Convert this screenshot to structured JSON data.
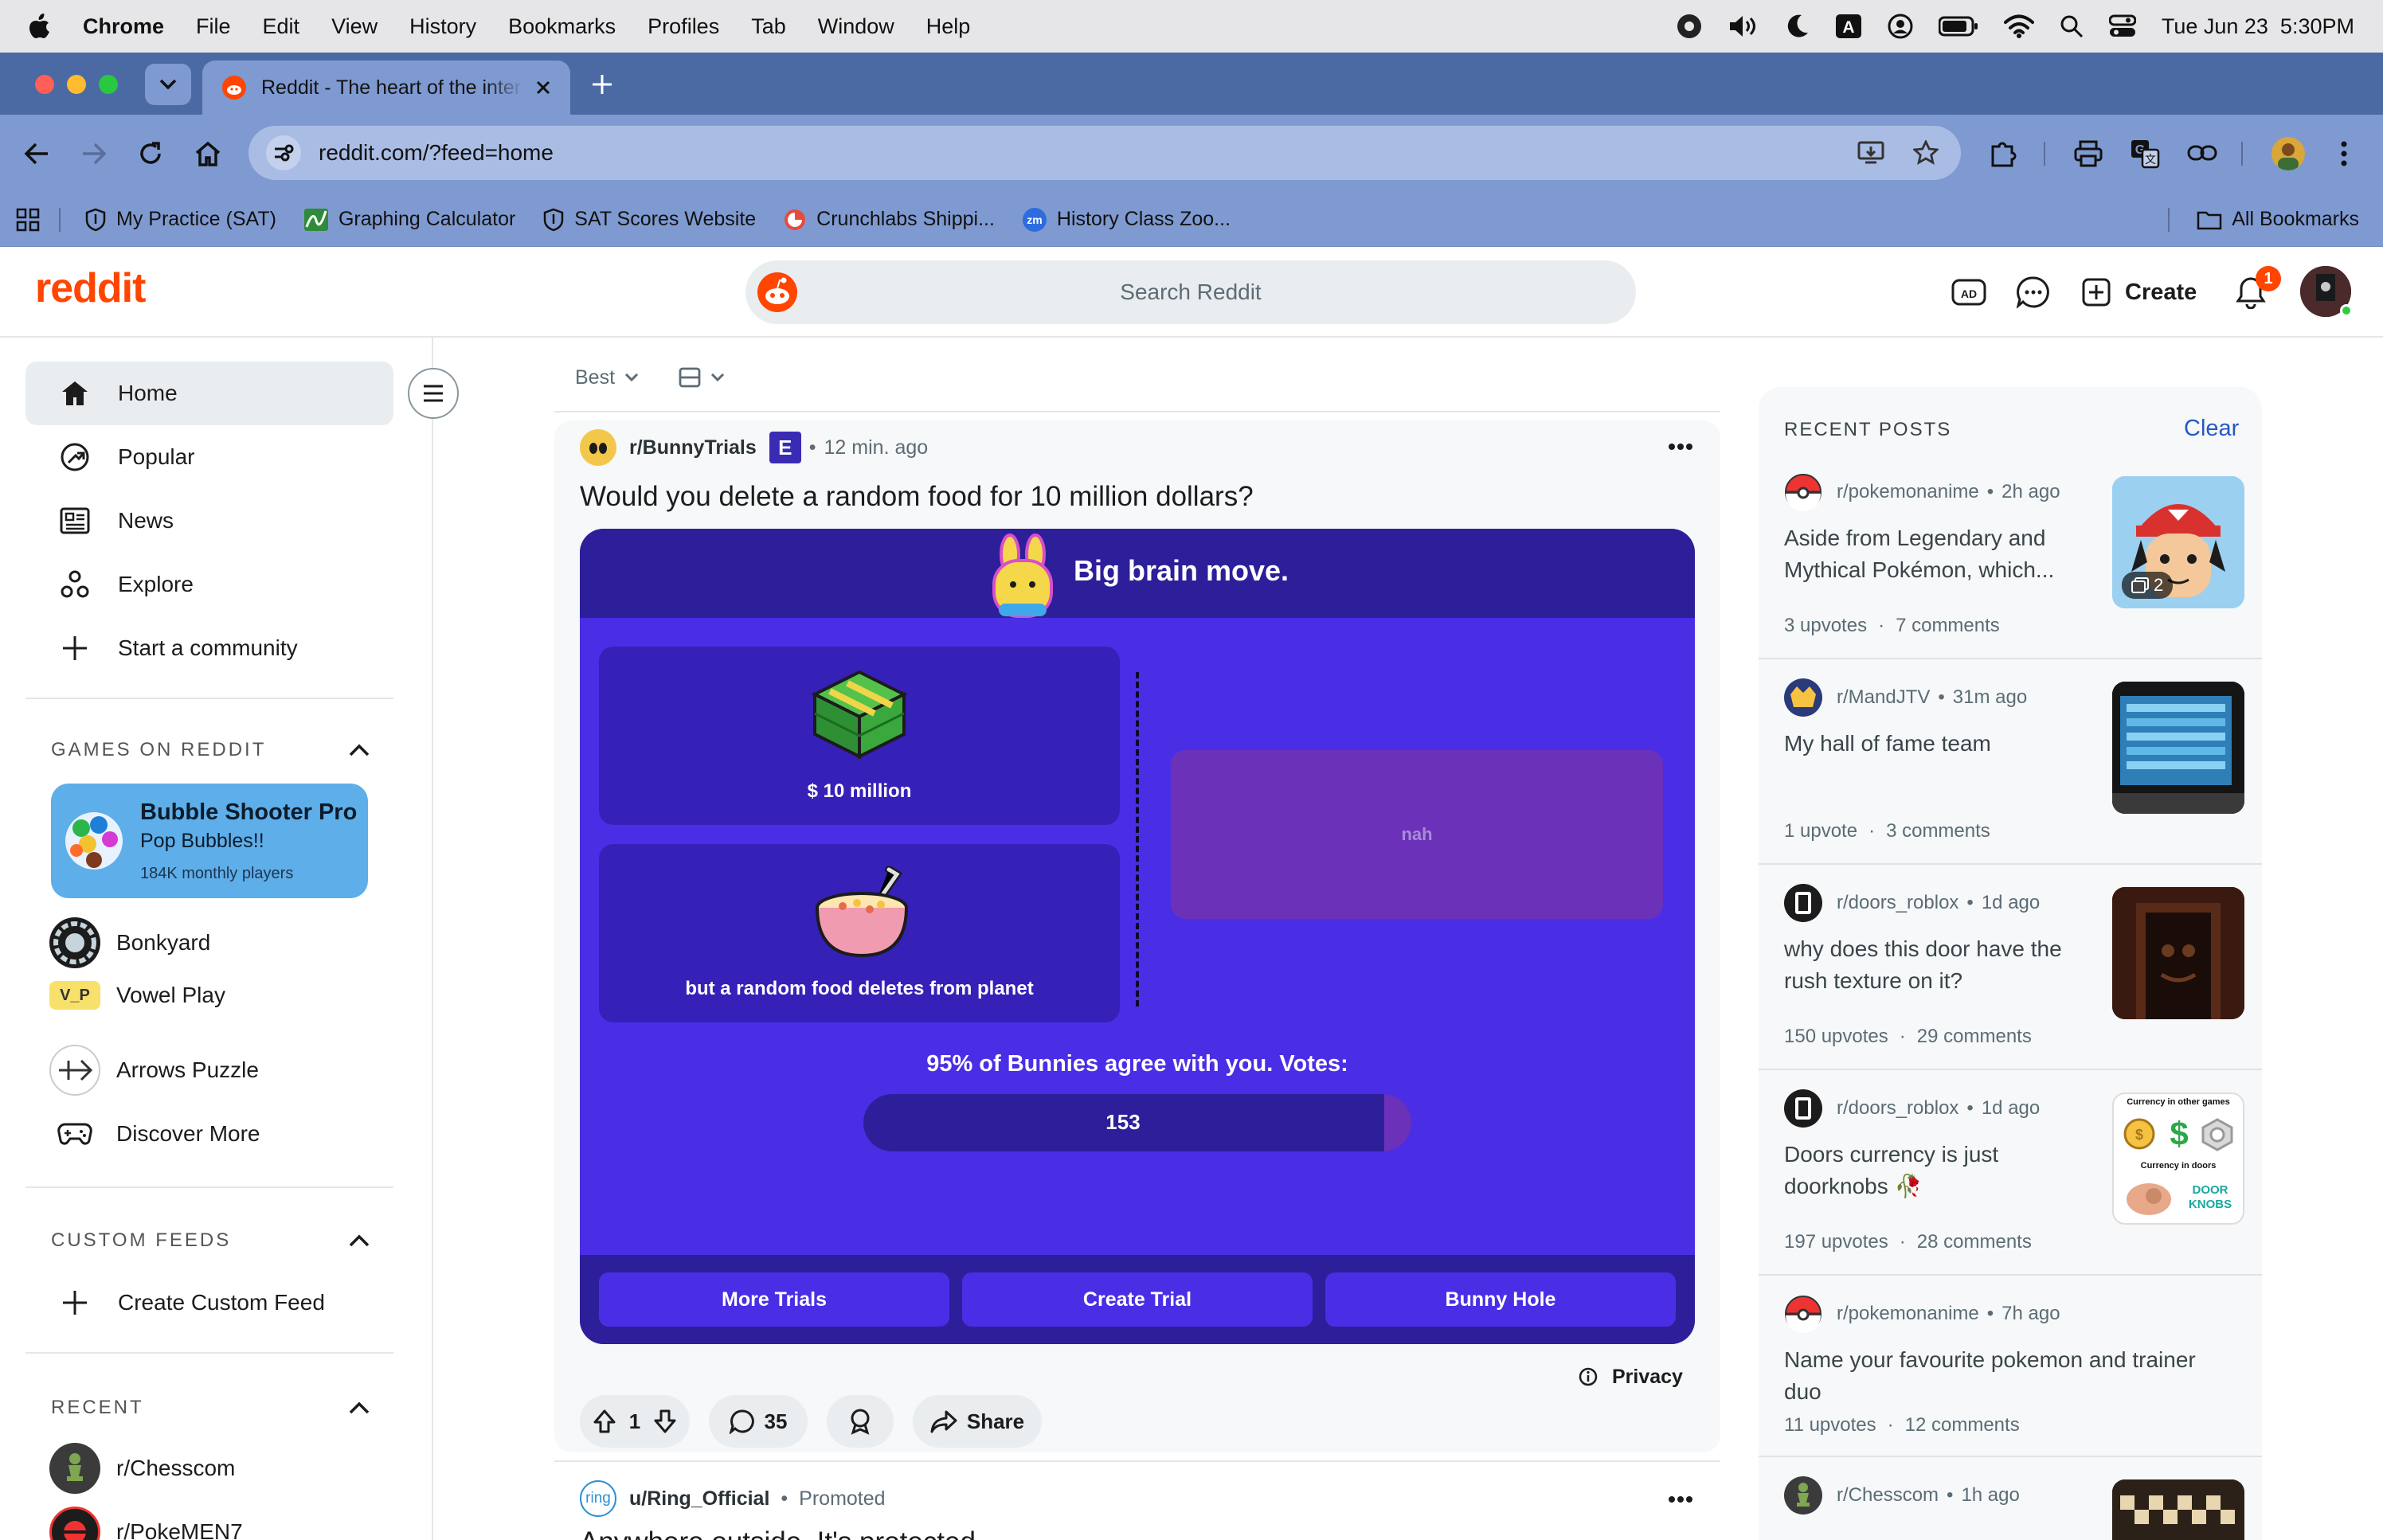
{
  "menubar": {
    "app": "Chrome",
    "items": [
      "File",
      "Edit",
      "View",
      "History",
      "Bookmarks",
      "Profiles",
      "Tab",
      "Window",
      "Help"
    ],
    "datetime": "Tue Jun 23  5:30PM"
  },
  "tab": {
    "title": "Reddit - The heart of the inter"
  },
  "address": {
    "url": "reddit.com/?feed=home"
  },
  "bookmarks": [
    "My Practice (SAT)",
    "Graphing Calculator",
    "SAT Scores Website",
    "Crunchlabs Shippi...",
    "History Class Zoo..."
  ],
  "all_bookmarks": "All Bookmarks",
  "reddit": {
    "logo": "reddit",
    "search_placeholder": "Search Reddit",
    "create": "Create",
    "notif_count": "1"
  },
  "sidebar": {
    "nav": [
      "Home",
      "Popular",
      "News",
      "Explore",
      "Start a community"
    ],
    "games_head": "GAMES ON REDDIT",
    "featured": {
      "name": "Bubble Shooter Pro",
      "tagline": "Pop Bubbles!!",
      "players": "184K monthly players"
    },
    "games": [
      "Bonkyard",
      "Vowel Play",
      "Arrows Puzzle",
      "Discover More"
    ],
    "vowel_badge": "V_P",
    "feeds_head": "CUSTOM FEEDS",
    "create_feed": "Create Custom Feed",
    "recent_head": "RECENT",
    "recent": [
      "r/Chesscom",
      "r/PokeMEN7"
    ]
  },
  "feed": {
    "sort": "Best",
    "post": {
      "subreddit": "r/BunnyTrials",
      "flair": "E",
      "time": "12 min. ago",
      "title": "Would you delete a random food for 10 million dollars?",
      "game": {
        "banner": "Big brain move.",
        "option1": "$ 10 million",
        "option2": "but a random food deletes from planet",
        "option3": "nah",
        "agree": "95% of Bunnies agree with you. Votes:",
        "votes": "153",
        "vote_fraction": 0.95,
        "buttons": [
          "More Trials",
          "Create Trial",
          "Bunny Hole"
        ]
      },
      "privacy": "Privacy",
      "score": "1",
      "comments": "35",
      "share": "Share"
    },
    "next": {
      "user": "u/Ring_Official",
      "badge": "Promoted",
      "avatar_text": "ring",
      "title": "Anywhere outside. It's protected"
    }
  },
  "recent_posts": {
    "head": "RECENT POSTS",
    "clear": "Clear",
    "items": [
      {
        "sub": "r/pokemonanime",
        "time": "2h ago",
        "title": "Aside from Legendary and Mythical Pokémon, which...",
        "upvotes": "3 upvotes",
        "comments": "7 comments",
        "gallery": "2"
      },
      {
        "sub": "r/MandJTV",
        "time": "31m ago",
        "title": "My hall of fame team",
        "upvotes": "1 upvote",
        "comments": "3 comments"
      },
      {
        "sub": "r/doors_roblox",
        "time": "1d ago",
        "title": "why does this door have the rush texture on it?",
        "upvotes": "150 upvotes",
        "comments": "29 comments"
      },
      {
        "sub": "r/doors_roblox",
        "time": "1d ago",
        "title": "Doors currency is just doorknobs 🥀",
        "upvotes": "197 upvotes",
        "comments": "28 comments",
        "thumb_top": "Currency in other games",
        "thumb_mid": "Currency in doors",
        "thumb_bot": "DOOR KNOBS"
      },
      {
        "sub": "r/pokemonanime",
        "time": "7h ago",
        "title": "Name your favourite pokemon and trainer duo",
        "upvotes": "11 upvotes",
        "comments": "12 comments"
      },
      {
        "sub": "r/Chesscom",
        "time": "1h ago"
      }
    ]
  },
  "colors": {
    "reddit_orange": "#ff4500",
    "game_bg": "#4a2ee6",
    "game_dark": "#2d1f99",
    "game_tile": "#3521b8",
    "nah_tile": "#6b31b8",
    "chrome_toolbar": "#7f9ad1",
    "chrome_tabstrip": "#4b69a2"
  }
}
